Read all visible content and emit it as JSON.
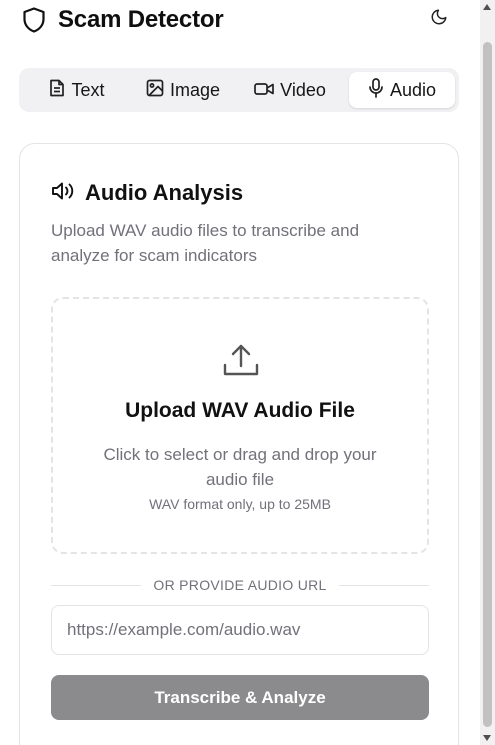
{
  "header": {
    "title": "Scam Detector",
    "logo_icon": "shield-icon",
    "theme_toggle_icon": "moon-icon"
  },
  "tabs": [
    {
      "label": "Text",
      "icon": "file-text-icon",
      "active": false
    },
    {
      "label": "Image",
      "icon": "image-icon",
      "active": false
    },
    {
      "label": "Video",
      "icon": "video-icon",
      "active": false
    },
    {
      "label": "Audio",
      "icon": "mic-icon",
      "active": true
    }
  ],
  "card": {
    "title": "Audio Analysis",
    "title_icon": "speaker-icon",
    "description": "Upload WAV audio files to transcribe and analyze for scam indicators"
  },
  "dropzone": {
    "icon": "upload-icon",
    "title": "Upload WAV Audio File",
    "subtitle": "Click to select or drag and drop your audio file",
    "hint": "WAV format only, up to 25MB"
  },
  "divider": {
    "label": "OR PROVIDE AUDIO URL"
  },
  "url_input": {
    "placeholder": "https://example.com/audio.wav",
    "value": ""
  },
  "submit_button": {
    "label": "Transcribe & Analyze"
  },
  "colors": {
    "active_tab_bg": "#ffffff",
    "tabs_bg": "#f1f1f3",
    "button_bg": "#8b8b8d",
    "muted_text": "#71717a",
    "border": "#e4e4e7"
  }
}
